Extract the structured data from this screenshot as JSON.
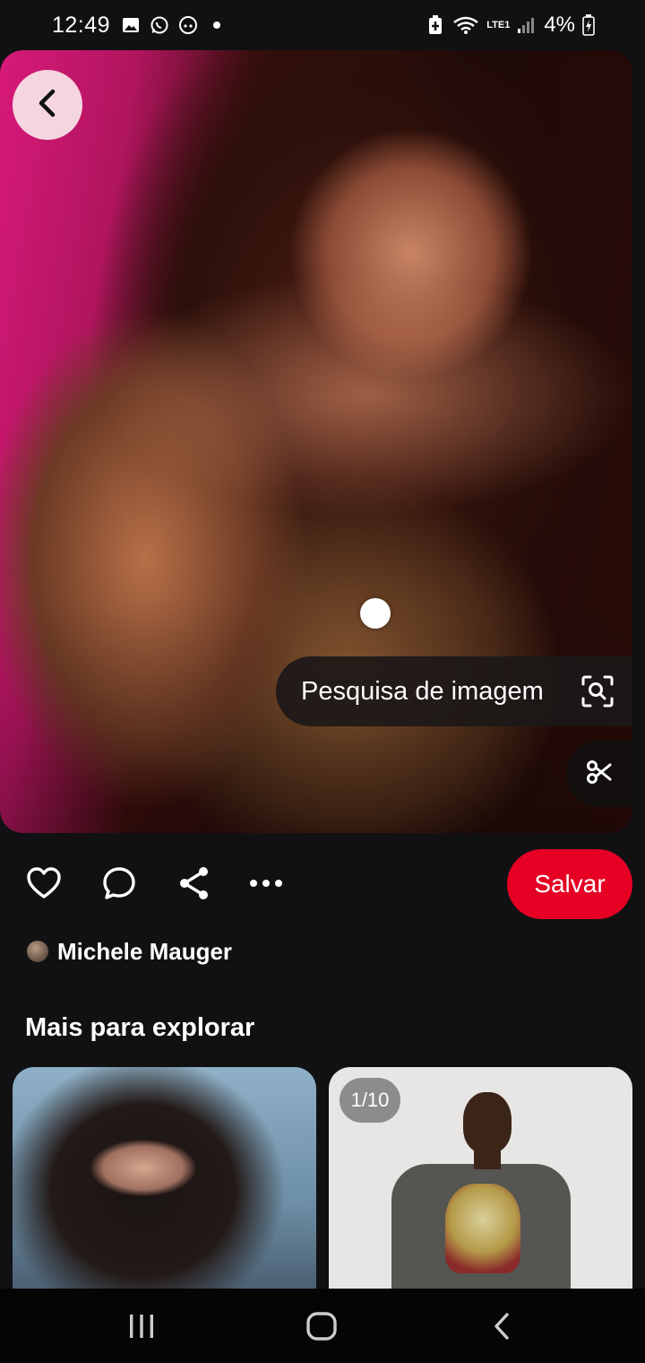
{
  "status_bar": {
    "time": "12:49",
    "battery_percent": "4%",
    "network_label": "LTE1",
    "icons": [
      "gallery-icon",
      "whatsapp-icon",
      "discord-icon",
      "dot-icon",
      "battery-saver-icon",
      "wifi-icon",
      "signal-icon",
      "battery-icon"
    ]
  },
  "hero": {
    "image_search_label": "Pesquisa de imagem",
    "back_icon": "chevron-left-icon",
    "lens_icon": "visual-search-icon",
    "crop_icon": "scissors-icon"
  },
  "actions": {
    "icons": [
      "heart-icon",
      "comment-icon",
      "share-icon",
      "more-icon"
    ],
    "save_label": "Salvar",
    "save_color": "#e60023"
  },
  "author": {
    "name": "Michele Mauger"
  },
  "explore": {
    "title": "Mais para explorar",
    "cards": [
      {
        "badge": ""
      },
      {
        "badge": "1/10"
      }
    ]
  },
  "nav_bar": {
    "icons": [
      "recents-icon",
      "home-icon",
      "back-icon"
    ]
  }
}
